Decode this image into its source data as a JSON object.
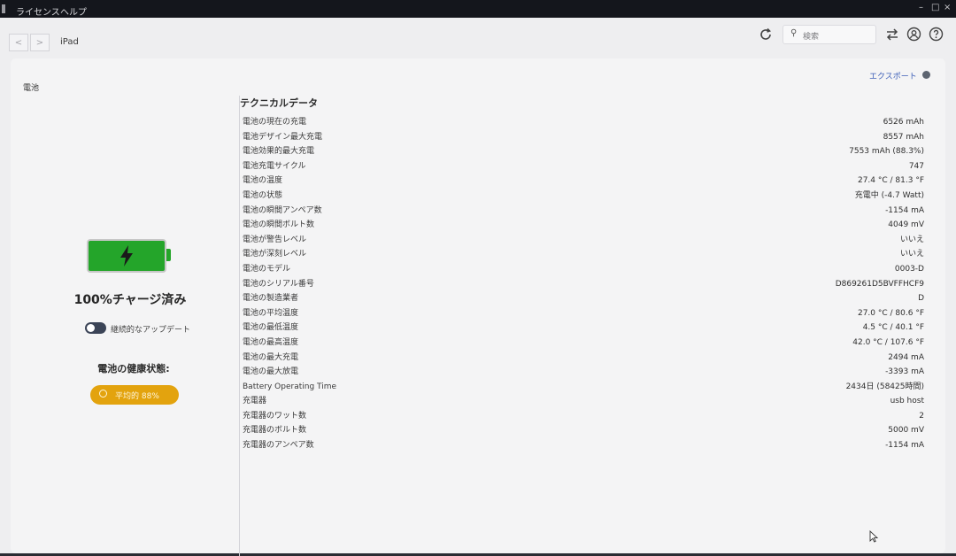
{
  "menu": {
    "items": [
      "ライセンス",
      "ヘルプ"
    ]
  },
  "window_controls": {
    "minimize": "–",
    "maximize": "□",
    "close": "×"
  },
  "toolbar": {
    "back": "<",
    "forward": ">",
    "breadcrumb": "iPad",
    "search_placeholder": "検索"
  },
  "section_title": "電池",
  "export_label": "エクスポート",
  "battery": {
    "charge_status": "100%チャージ済み",
    "continuous_update_label": "継続的なアップデート",
    "health_label": "電池の健康状態:",
    "health_badge": "平均的 88%",
    "level_fraction": 1.0
  },
  "technical": {
    "title": "テクニカルデータ",
    "rows": [
      {
        "label": "電池の現在の充電",
        "value": "6526 mAh"
      },
      {
        "label": "電池デザイン最大充電",
        "value": "8557 mAh"
      },
      {
        "label": "電池効果的最大充電",
        "value": "7553 mAh (88.3%)"
      },
      {
        "label": "電池充電サイクル",
        "value": "747"
      },
      {
        "label": "電池の温度",
        "value": "27.4 °C / 81.3 °F"
      },
      {
        "label": "電池の状態",
        "value": "充電中 (-4.7 Watt)"
      },
      {
        "label": "電池の瞬間アンペア数",
        "value": "-1154 mA"
      },
      {
        "label": "電池の瞬間ボルト数",
        "value": "4049 mV"
      },
      {
        "label": "電池が警告レベル",
        "value": "いいえ"
      },
      {
        "label": "電池が深刻レベル",
        "value": "いいえ"
      },
      {
        "label": "電池のモデル",
        "value": "0003-D"
      },
      {
        "label": "電池のシリアル番号",
        "value": "D869261D5BVFFHCF9"
      },
      {
        "label": "電池の製造業者",
        "value": "D"
      },
      {
        "label": "電池の平均温度",
        "value": "27.0 °C / 80.6 °F"
      },
      {
        "label": "電池の最低温度",
        "value": "4.5 °C / 40.1 °F"
      },
      {
        "label": "電池の最高温度",
        "value": "42.0 °C / 107.6 °F"
      },
      {
        "label": "電池の最大充電",
        "value": "2494 mA"
      },
      {
        "label": "電池の最大放電",
        "value": "-3393 mA"
      },
      {
        "label": "Battery Operating Time",
        "value": "2434日 (58425時間)"
      },
      {
        "label": "充電器",
        "value": "usb host"
      },
      {
        "label": "充電器のワット数",
        "value": "2"
      },
      {
        "label": "充電器のボルト数",
        "value": "5000 mV"
      },
      {
        "label": "充電器のアンペア数",
        "value": "-1154 mA"
      }
    ]
  },
  "colors": {
    "battery_fill": "#24a52a",
    "health_badge": "#e3a30e",
    "export_link": "#3d5fb8"
  }
}
